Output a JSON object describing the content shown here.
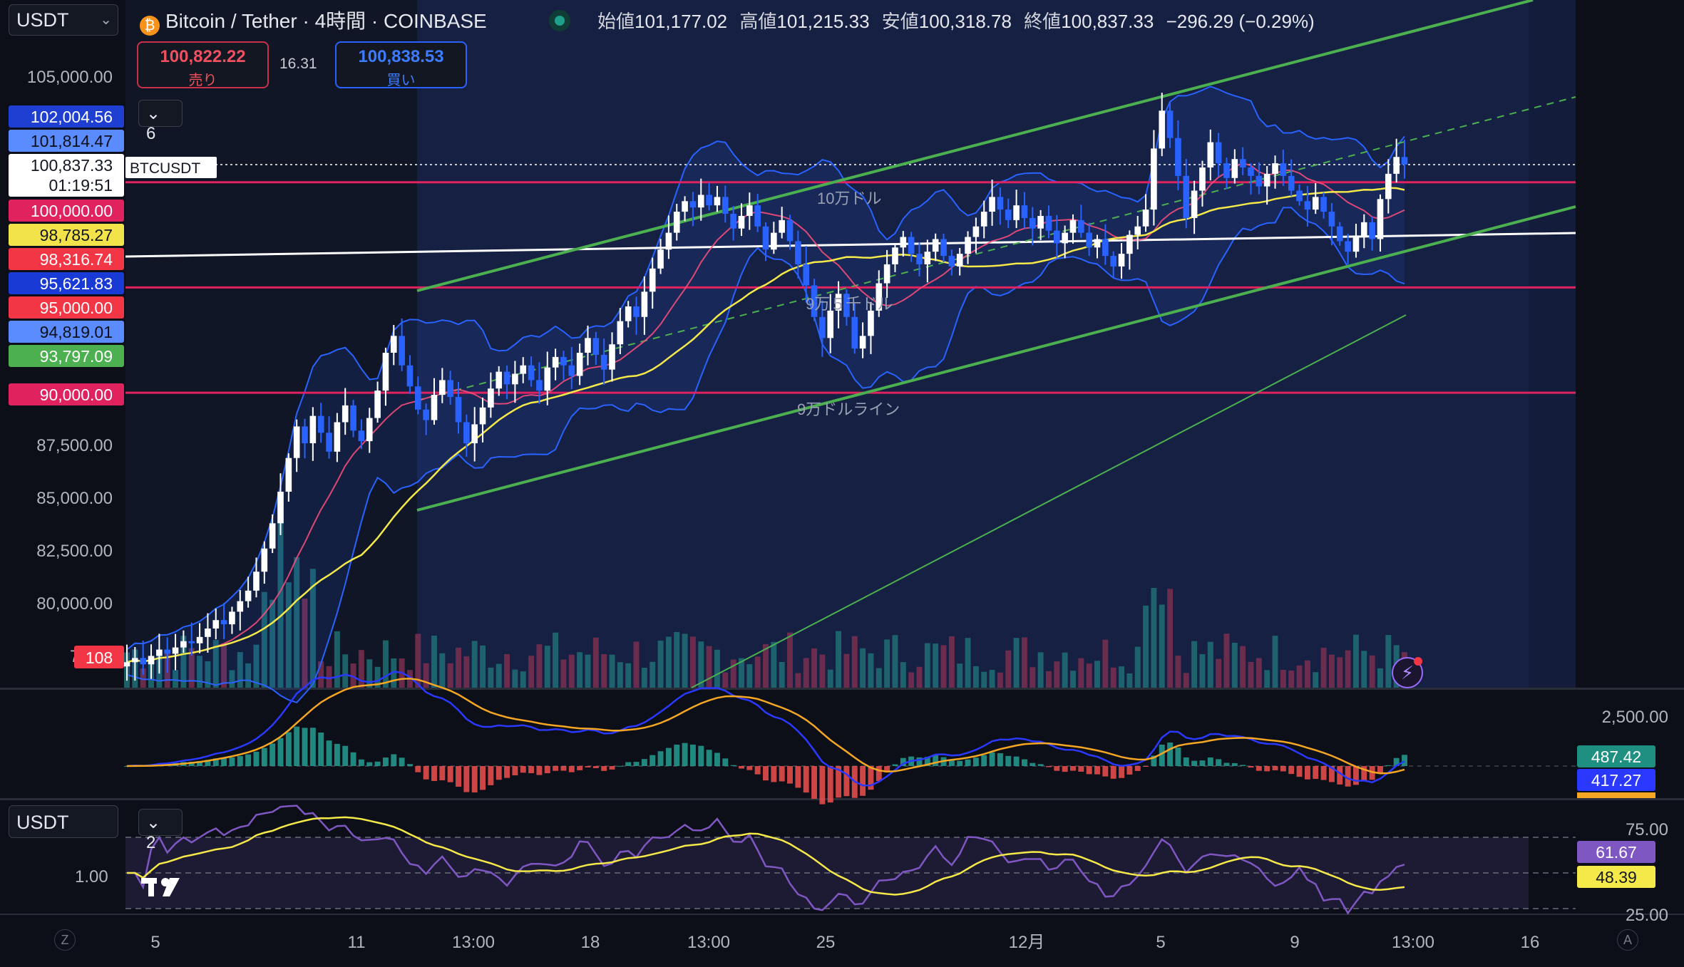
{
  "header": {
    "symbol_select": "USDT",
    "title": "Bitcoin / Tether · 4時間 · COINBASE",
    "ohlc": {
      "open_label": "始値",
      "open": "101,177.02",
      "high_label": "高値",
      "high": "101,215.33",
      "low_label": "安値",
      "low": "100,318.78",
      "close_label": "終値",
      "close": "100,837.33",
      "change": "−296.29 (−0.29%)"
    }
  },
  "trade": {
    "sell_price": "100,822.22",
    "sell_label": "売り",
    "spread": "16.31",
    "buy_price": "100,838.53",
    "buy_label": "買い"
  },
  "indicator_toggle": {
    "label": "6"
  },
  "rsi_toggle": {
    "label": "2"
  },
  "rsi_symbol_select": "USDT",
  "price_axis": {
    "ticks": [
      "105,000.00",
      "87,500.00",
      "85,000.00",
      "82,500.00",
      "80,000.00",
      "77,50"
    ],
    "volume_badge": "108",
    "badges": [
      {
        "text": "102,004.56",
        "bg": "#1e3fd1",
        "fg": "#ffffff"
      },
      {
        "text": "101,814.47",
        "bg": "#5b8cff",
        "fg": "#0c0f17"
      },
      {
        "text": "100,837.33",
        "time": "01:19:51",
        "bg": "#ffffff",
        "fg": "#131722"
      },
      {
        "text": "100,000.00",
        "bg": "#e0225f",
        "fg": "#ffffff"
      },
      {
        "text": "98,785.27",
        "bg": "#f2e34a",
        "fg": "#131722"
      },
      {
        "text": "98,316.74",
        "bg": "#f23645",
        "fg": "#ffffff"
      },
      {
        "text": "95,621.83",
        "bg": "#1a3ad6",
        "fg": "#ffffff"
      },
      {
        "text": "95,000.00",
        "bg": "#f23645",
        "fg": "#ffffff"
      },
      {
        "text": "94,819.01",
        "bg": "#5b8cff",
        "fg": "#0c0f17"
      },
      {
        "text": "93,797.09",
        "bg": "#4caf50",
        "fg": "#ffffff"
      },
      {
        "text": "90,000.00",
        "bg": "#e0225f",
        "fg": "#ffffff"
      }
    ],
    "symbol_tag": "BTCUSDT"
  },
  "annotations": {
    "line_100k": "10万ドル",
    "line_95k": "9万５千ドル",
    "line_90k": "9万ドルライン"
  },
  "macd_axis": {
    "tick": "2,500.00",
    "badges": [
      {
        "text": "487.42",
        "bg": "#1e8f80",
        "fg": "#ffffff"
      },
      {
        "text": "417.27",
        "bg": "#2b38ff",
        "fg": "#ffffff"
      }
    ]
  },
  "rsi_axis": {
    "ticks": [
      "75.00",
      "25.00"
    ],
    "left_tick": "1.00",
    "badges": [
      {
        "text": "61.67",
        "bg": "#7e57c2",
        "fg": "#ffffff"
      },
      {
        "text": "48.39",
        "bg": "#f5e94a",
        "fg": "#131722"
      }
    ]
  },
  "time_axis": {
    "labels": [
      "5",
      "11",
      "13:00",
      "18",
      "13:00",
      "25",
      "12月",
      "5",
      "9",
      "13:00",
      "16"
    ],
    "left_corner": "Z",
    "right_corner": "A"
  },
  "colors": {
    "background": "#0c0f17",
    "up_candle": "#ffffff",
    "down_candle": "#2962ff",
    "channel": "#4caf50",
    "level_line": "#e0225f",
    "ma_fast": "#ff4f7b",
    "ma_slow": "#f5e94a",
    "ma_long": "#4caf50",
    "bollinger": "#2962ff",
    "macd": "#2b38ff",
    "macd_signal": "#f5a623",
    "rsi": "#7e57c2"
  },
  "chart_data": {
    "type": "candlestick",
    "symbol": "BTCUSDT",
    "timeframe": "4H",
    "ylim": [
      76000,
      108000
    ],
    "levels": [
      90000,
      95000,
      100000
    ],
    "close_series": [
      77200,
      77400,
      77100,
      77500,
      77800,
      77600,
      77900,
      78200,
      78100,
      78400,
      78800,
      79200,
      79000,
      79600,
      80100,
      80600,
      81500,
      82600,
      83800,
      85300,
      86900,
      88400,
      87600,
      88900,
      88100,
      87200,
      88600,
      89400,
      88200,
      87700,
      88800,
      90100,
      91900,
      92700,
      91300,
      90300,
      89200,
      88700,
      89900,
      90600,
      89800,
      88600,
      87600,
      88500,
      89300,
      90200,
      91000,
      90400,
      90900,
      91300,
      90600,
      90100,
      91200,
      91700,
      91300,
      90800,
      91900,
      92600,
      91800,
      91100,
      92300,
      93400,
      94100,
      93600,
      94800,
      95900,
      96800,
      97600,
      98600,
      99100,
      98800,
      99400,
      98900,
      99300,
      98500,
      97800,
      98400,
      98900,
      97900,
      96800,
      97600,
      98200,
      97200,
      96100,
      95100,
      93600,
      92600,
      93900,
      94700,
      93600,
      92100,
      92700,
      93900,
      95200,
      96100,
      96900,
      97400,
      96600,
      96100,
      96700,
      97300,
      96500,
      96000,
      96600,
      97400,
      97900,
      98600,
      99300,
      98700,
      98200,
      98900,
      98300,
      97800,
      98400,
      97700,
      97100,
      97600,
      98200,
      97600,
      96900,
      97300,
      96500,
      96000,
      96600,
      97500,
      97900,
      98700,
      101600,
      103400,
      102100,
      100300,
      98300,
      99600,
      100700,
      101900,
      100900,
      100200,
      101100,
      100700,
      100300,
      99800,
      100400,
      100900,
      100300,
      99600,
      99100,
      98700,
      99300,
      98600,
      97900,
      97200,
      96700,
      97400,
      98100,
      97300,
      99200,
      100400,
      101200,
      100837
    ]
  }
}
